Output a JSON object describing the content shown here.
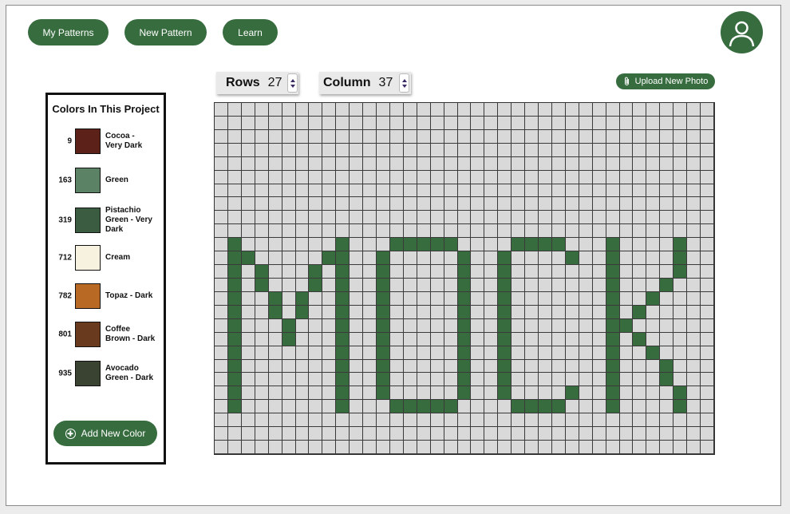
{
  "nav": {
    "my_patterns": "My Patterns",
    "new_pattern": "New Pattern",
    "learn": "Learn"
  },
  "user": {
    "avatar_icon": "user-icon"
  },
  "sidebar": {
    "title": "Colors In This Project",
    "colors": [
      {
        "number": "9",
        "name": "Cocoa -\nVery Dark",
        "hex": "#5c2118"
      },
      {
        "number": "163",
        "name": "Green",
        "hex": "#5b8264"
      },
      {
        "number": "319",
        "name": "Pistachio\nGreen - Very\nDark",
        "hex": "#3b5c41"
      },
      {
        "number": "712",
        "name": "Cream",
        "hex": "#f7f1df"
      },
      {
        "number": "782",
        "name": "Topaz - Dark",
        "hex": "#b86a24"
      },
      {
        "number": "801",
        "name": "Coffee\nBrown - Dark",
        "hex": "#6a3a1e"
      },
      {
        "number": "935",
        "name": "Avocado\nGreen - Dark",
        "hex": "#3a4332"
      }
    ],
    "add_color_label": "Add New Color"
  },
  "pattern": {
    "rows_label": "Rows",
    "rows_value": "27",
    "column_label": "Column",
    "column_value": "37",
    "upload_label": "Upload New Photo",
    "stitch_color": "#376c3f",
    "background_color": "#d9d9d9",
    "filled_cells": [
      [
        10,
        1
      ],
      [
        11,
        1
      ],
      [
        12,
        1
      ],
      [
        13,
        1
      ],
      [
        14,
        1
      ],
      [
        15,
        1
      ],
      [
        16,
        1
      ],
      [
        17,
        1
      ],
      [
        18,
        1
      ],
      [
        19,
        1
      ],
      [
        20,
        1
      ],
      [
        21,
        1
      ],
      [
        22,
        1
      ],
      [
        11,
        2
      ],
      [
        12,
        3
      ],
      [
        13,
        3
      ],
      [
        14,
        4
      ],
      [
        15,
        4
      ],
      [
        16,
        5
      ],
      [
        17,
        5
      ],
      [
        15,
        6
      ],
      [
        14,
        6
      ],
      [
        13,
        7
      ],
      [
        12,
        7
      ],
      [
        11,
        8
      ],
      [
        10,
        9
      ],
      [
        11,
        9
      ],
      [
        12,
        9
      ],
      [
        13,
        9
      ],
      [
        14,
        9
      ],
      [
        15,
        9
      ],
      [
        16,
        9
      ],
      [
        17,
        9
      ],
      [
        18,
        9
      ],
      [
        19,
        9
      ],
      [
        20,
        9
      ],
      [
        21,
        9
      ],
      [
        22,
        9
      ],
      [
        11,
        12
      ],
      [
        12,
        12
      ],
      [
        13,
        12
      ],
      [
        14,
        12
      ],
      [
        15,
        12
      ],
      [
        16,
        12
      ],
      [
        17,
        12
      ],
      [
        18,
        12
      ],
      [
        19,
        12
      ],
      [
        20,
        12
      ],
      [
        21,
        12
      ],
      [
        10,
        13
      ],
      [
        10,
        14
      ],
      [
        10,
        15
      ],
      [
        10,
        16
      ],
      [
        10,
        17
      ],
      [
        22,
        13
      ],
      [
        22,
        14
      ],
      [
        22,
        15
      ],
      [
        22,
        16
      ],
      [
        22,
        17
      ],
      [
        11,
        18
      ],
      [
        12,
        18
      ],
      [
        13,
        18
      ],
      [
        14,
        18
      ],
      [
        15,
        18
      ],
      [
        16,
        18
      ],
      [
        17,
        18
      ],
      [
        18,
        18
      ],
      [
        19,
        18
      ],
      [
        20,
        18
      ],
      [
        21,
        18
      ],
      [
        11,
        21
      ],
      [
        12,
        21
      ],
      [
        13,
        21
      ],
      [
        14,
        21
      ],
      [
        15,
        21
      ],
      [
        16,
        21
      ],
      [
        17,
        21
      ],
      [
        18,
        21
      ],
      [
        19,
        21
      ],
      [
        20,
        21
      ],
      [
        21,
        21
      ],
      [
        10,
        22
      ],
      [
        10,
        23
      ],
      [
        10,
        24
      ],
      [
        10,
        25
      ],
      [
        11,
        26
      ],
      [
        22,
        22
      ],
      [
        22,
        23
      ],
      [
        22,
        24
      ],
      [
        22,
        25
      ],
      [
        21,
        26
      ],
      [
        10,
        29
      ],
      [
        11,
        29
      ],
      [
        12,
        29
      ],
      [
        13,
        29
      ],
      [
        14,
        29
      ],
      [
        15,
        29
      ],
      [
        16,
        29
      ],
      [
        17,
        29
      ],
      [
        18,
        29
      ],
      [
        19,
        29
      ],
      [
        20,
        29
      ],
      [
        21,
        29
      ],
      [
        22,
        29
      ],
      [
        16,
        30
      ],
      [
        15,
        31
      ],
      [
        14,
        32
      ],
      [
        13,
        33
      ],
      [
        12,
        34
      ],
      [
        11,
        34
      ],
      [
        10,
        34
      ],
      [
        17,
        31
      ],
      [
        18,
        32
      ],
      [
        19,
        33
      ],
      [
        20,
        33
      ],
      [
        21,
        34
      ],
      [
        22,
        34
      ]
    ]
  }
}
